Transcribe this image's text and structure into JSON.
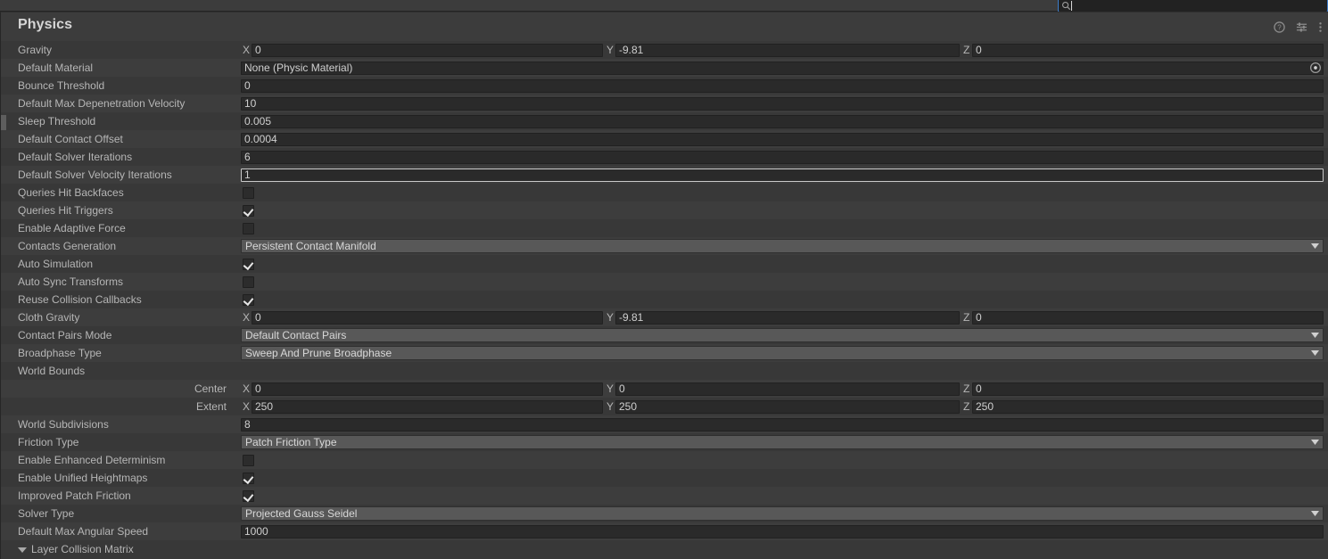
{
  "toolbar": {
    "search": {
      "value": "",
      "placeholder": "",
      "icon": "search-icon"
    }
  },
  "header": {
    "title": "Physics",
    "icons": [
      {
        "name": "help-icon",
        "label": "?"
      },
      {
        "name": "preset-icon",
        "label": "Preset"
      },
      {
        "name": "kebab-menu-icon",
        "label": "More"
      }
    ]
  },
  "colors": {
    "panel_bg": "#383838",
    "row_alt_bg": "#3d3d3d",
    "field_bg": "#2a2a2a",
    "dropdown_bg": "#585858",
    "focus_border": "#3d7cc9",
    "text": "#b6b6b6"
  },
  "rows": [
    {
      "name": "gravity",
      "label": "Gravity",
      "type": "vector3",
      "axes": [
        "X",
        "Y",
        "Z"
      ],
      "values": [
        "0",
        "-9.81",
        "0"
      ]
    },
    {
      "name": "default-material",
      "label": "Default Material",
      "type": "object",
      "value": "None (Physic Material)",
      "picker_icon": "object-select-icon"
    },
    {
      "name": "bounce-threshold",
      "label": "Bounce Threshold",
      "type": "number",
      "value": "0"
    },
    {
      "name": "default-max-depenetration-velocity",
      "label": "Default Max Depenetration Velocity",
      "type": "number",
      "value": "10"
    },
    {
      "name": "sleep-threshold",
      "label": "Sleep Threshold",
      "type": "number",
      "value": "0.005"
    },
    {
      "name": "default-contact-offset",
      "label": "Default Contact Offset",
      "type": "number",
      "value": "0.0004"
    },
    {
      "name": "default-solver-iterations",
      "label": "Default Solver Iterations",
      "type": "number",
      "value": "6"
    },
    {
      "name": "default-solver-velocity-iterations",
      "label": "Default Solver Velocity Iterations",
      "type": "number",
      "value": "1",
      "focused": true
    },
    {
      "name": "queries-hit-backfaces",
      "label": "Queries Hit Backfaces",
      "type": "checkbox",
      "checked": false
    },
    {
      "name": "queries-hit-triggers",
      "label": "Queries Hit Triggers",
      "type": "checkbox",
      "checked": true
    },
    {
      "name": "enable-adaptive-force",
      "label": "Enable Adaptive Force",
      "type": "checkbox",
      "checked": false
    },
    {
      "name": "contacts-generation",
      "label": "Contacts Generation",
      "type": "dropdown",
      "value": "Persistent Contact Manifold"
    },
    {
      "name": "auto-simulation",
      "label": "Auto Simulation",
      "type": "checkbox",
      "checked": true
    },
    {
      "name": "auto-sync-transforms",
      "label": "Auto Sync Transforms",
      "type": "checkbox",
      "checked": false
    },
    {
      "name": "reuse-collision-callbacks",
      "label": "Reuse Collision Callbacks",
      "type": "checkbox",
      "checked": true
    },
    {
      "name": "cloth-gravity",
      "label": "Cloth Gravity",
      "type": "vector3",
      "axes": [
        "X",
        "Y",
        "Z"
      ],
      "values": [
        "0",
        "-9.81",
        "0"
      ]
    },
    {
      "name": "contact-pairs-mode",
      "label": "Contact Pairs Mode",
      "type": "dropdown",
      "value": "Default Contact Pairs"
    },
    {
      "name": "broadphase-type",
      "label": "Broadphase Type",
      "type": "dropdown",
      "value": "Sweep And Prune Broadphase"
    },
    {
      "name": "world-bounds",
      "label": "World Bounds",
      "type": "group"
    },
    {
      "name": "world-bounds-center",
      "label": "Center",
      "type": "vector3-sub",
      "axes": [
        "X",
        "Y",
        "Z"
      ],
      "values": [
        "0",
        "0",
        "0"
      ]
    },
    {
      "name": "world-bounds-extent",
      "label": "Extent",
      "type": "vector3-sub",
      "axes": [
        "X",
        "Y",
        "Z"
      ],
      "values": [
        "250",
        "250",
        "250"
      ]
    },
    {
      "name": "world-subdivisions",
      "label": "World Subdivisions",
      "type": "number",
      "value": "8"
    },
    {
      "name": "friction-type",
      "label": "Friction Type",
      "type": "dropdown",
      "value": "Patch Friction Type"
    },
    {
      "name": "enable-enhanced-determinism",
      "label": "Enable Enhanced Determinism",
      "type": "checkbox",
      "checked": false
    },
    {
      "name": "enable-unified-heightmaps",
      "label": "Enable Unified Heightmaps",
      "type": "checkbox",
      "checked": true
    },
    {
      "name": "improved-patch-friction",
      "label": "Improved Patch Friction",
      "type": "checkbox",
      "checked": true
    },
    {
      "name": "solver-type",
      "label": "Solver Type",
      "type": "dropdown",
      "value": "Projected Gauss Seidel"
    },
    {
      "name": "default-max-angular-speed",
      "label": "Default Max Angular Speed",
      "type": "number",
      "value": "1000"
    },
    {
      "name": "layer-collision-matrix",
      "label": "Layer Collision Matrix",
      "type": "foldout",
      "expanded": true
    }
  ]
}
